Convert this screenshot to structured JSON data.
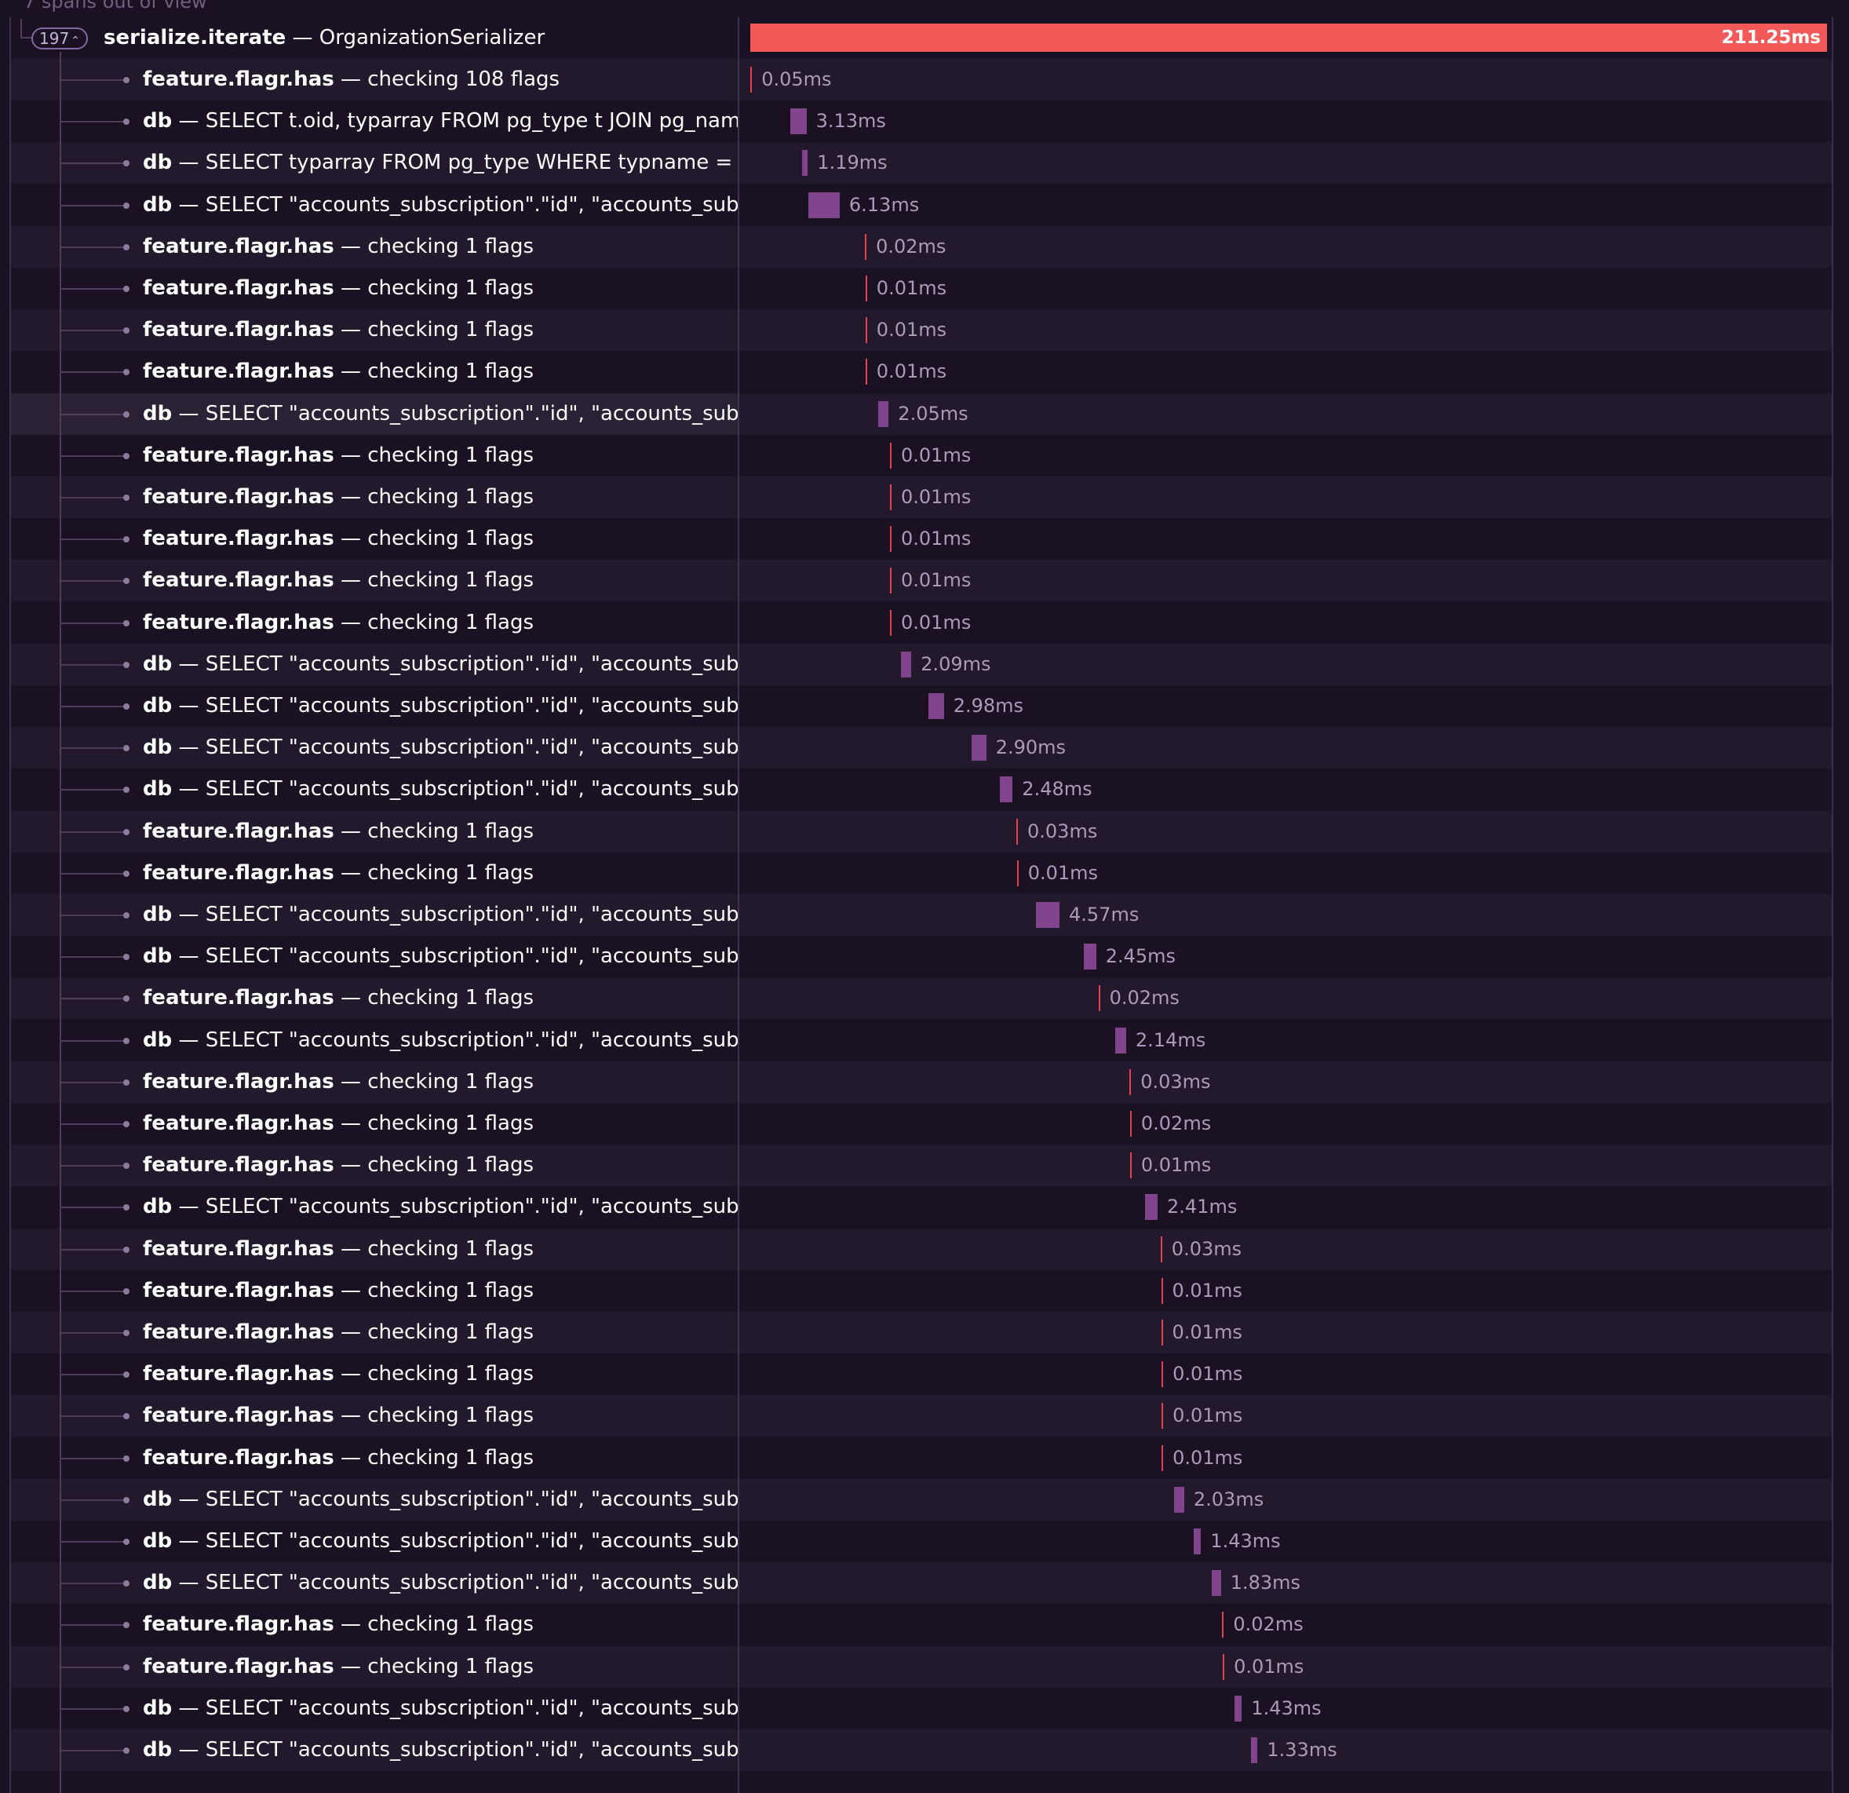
{
  "header": {
    "out_of_view": "7 spans out of view"
  },
  "root": {
    "count": "197",
    "op": "serialize.iterate",
    "sep": " — ",
    "desc": "OrganizationSerializer",
    "duration": "211.25ms"
  },
  "colors": {
    "root_bar": "#f25a5a",
    "db_bar": "#80448c",
    "flag_bar": "#e6414f",
    "background": "#1a1222",
    "row_alt": "#221a2c"
  },
  "spans": [
    {
      "type": "flag",
      "op": "feature.flagr.has",
      "desc": "checking 108 flags",
      "duration": "0.05ms",
      "start_ms": 0.03,
      "dur_ms": 0.05
    },
    {
      "type": "db",
      "op": "db",
      "desc": "SELECT t.oid, typarray FROM pg_type t JOIN pg_namespace ns ON typnamespace = ns.oid WHERE typname = 'hstore'",
      "duration": "3.13ms",
      "start_ms": 7.9,
      "dur_ms": 3.13
    },
    {
      "type": "db",
      "op": "db",
      "desc": "SELECT typarray FROM pg_type WHERE typname = 'citext'",
      "duration": "1.19ms",
      "start_ms": 10.1,
      "dur_ms": 1.19
    },
    {
      "type": "db",
      "op": "db",
      "desc": "SELECT \"accounts_subscription\".\"id\", \"accounts_subscription\".\"organization_id\"",
      "duration": "6.13ms",
      "start_ms": 11.4,
      "dur_ms": 6.13
    },
    {
      "type": "flag",
      "op": "feature.flagr.has",
      "desc": "checking 1 flags",
      "duration": "0.02ms",
      "start_ms": 22.5,
      "dur_ms": 0.02
    },
    {
      "type": "flag",
      "op": "feature.flagr.has",
      "desc": "checking 1 flags",
      "duration": "0.01ms",
      "start_ms": 22.6,
      "dur_ms": 0.01
    },
    {
      "type": "flag",
      "op": "feature.flagr.has",
      "desc": "checking 1 flags",
      "duration": "0.01ms",
      "start_ms": 22.6,
      "dur_ms": 0.01
    },
    {
      "type": "flag",
      "op": "feature.flagr.has",
      "desc": "checking 1 flags",
      "duration": "0.01ms",
      "start_ms": 22.6,
      "dur_ms": 0.01
    },
    {
      "type": "db",
      "op": "db",
      "desc": "SELECT \"accounts_subscription\".\"id\", \"accounts_subscription\".\"organization_id\"",
      "duration": "2.05ms",
      "start_ms": 25.1,
      "dur_ms": 2.05
    },
    {
      "type": "flag",
      "op": "feature.flagr.has",
      "desc": "checking 1 flags",
      "duration": "0.01ms",
      "start_ms": 27.4,
      "dur_ms": 0.01
    },
    {
      "type": "flag",
      "op": "feature.flagr.has",
      "desc": "checking 1 flags",
      "duration": "0.01ms",
      "start_ms": 27.4,
      "dur_ms": 0.01
    },
    {
      "type": "flag",
      "op": "feature.flagr.has",
      "desc": "checking 1 flags",
      "duration": "0.01ms",
      "start_ms": 27.4,
      "dur_ms": 0.01
    },
    {
      "type": "flag",
      "op": "feature.flagr.has",
      "desc": "checking 1 flags",
      "duration": "0.01ms",
      "start_ms": 27.4,
      "dur_ms": 0.01
    },
    {
      "type": "flag",
      "op": "feature.flagr.has",
      "desc": "checking 1 flags",
      "duration": "0.01ms",
      "start_ms": 27.4,
      "dur_ms": 0.01
    },
    {
      "type": "db",
      "op": "db",
      "desc": "SELECT \"accounts_subscription\".\"id\", \"accounts_subscription\".\"organization_id\"",
      "duration": "2.09ms",
      "start_ms": 29.5,
      "dur_ms": 2.09
    },
    {
      "type": "db",
      "op": "db",
      "desc": "SELECT \"accounts_subscription\".\"id\", \"accounts_subscription\".\"organization_id\"",
      "duration": "2.98ms",
      "start_ms": 35.0,
      "dur_ms": 2.98
    },
    {
      "type": "db",
      "op": "db",
      "desc": "SELECT \"accounts_subscription\".\"id\", \"accounts_subscription\".\"organization_id\"",
      "duration": "2.90ms",
      "start_ms": 43.4,
      "dur_ms": 2.9
    },
    {
      "type": "db",
      "op": "db",
      "desc": "SELECT \"accounts_subscription\".\"id\", \"accounts_subscription\".\"organization_id\"",
      "duration": "2.48ms",
      "start_ms": 49.0,
      "dur_ms": 2.48
    },
    {
      "type": "flag",
      "op": "feature.flagr.has",
      "desc": "checking 1 flags",
      "duration": "0.03ms",
      "start_ms": 52.2,
      "dur_ms": 0.03
    },
    {
      "type": "flag",
      "op": "feature.flagr.has",
      "desc": "checking 1 flags",
      "duration": "0.01ms",
      "start_ms": 52.3,
      "dur_ms": 0.01
    },
    {
      "type": "db",
      "op": "db",
      "desc": "SELECT \"accounts_subscription\".\"id\", \"accounts_subscription\".\"organization_id\"",
      "duration": "4.57ms",
      "start_ms": 56.1,
      "dur_ms": 4.57
    },
    {
      "type": "db",
      "op": "db",
      "desc": "SELECT \"accounts_subscription\".\"id\", \"accounts_subscription\".\"organization_id\"",
      "duration": "2.45ms",
      "start_ms": 65.4,
      "dur_ms": 2.45
    },
    {
      "type": "flag",
      "op": "feature.flagr.has",
      "desc": "checking 1 flags",
      "duration": "0.02ms",
      "start_ms": 68.3,
      "dur_ms": 0.02
    },
    {
      "type": "db",
      "op": "db",
      "desc": "SELECT \"accounts_subscription\".\"id\", \"accounts_subscription\".\"organization_id\"",
      "duration": "2.14ms",
      "start_ms": 71.6,
      "dur_ms": 2.14
    },
    {
      "type": "flag",
      "op": "feature.flagr.has",
      "desc": "checking 1 flags",
      "duration": "0.03ms",
      "start_ms": 74.4,
      "dur_ms": 0.03
    },
    {
      "type": "flag",
      "op": "feature.flagr.has",
      "desc": "checking 1 flags",
      "duration": "0.02ms",
      "start_ms": 74.5,
      "dur_ms": 0.02
    },
    {
      "type": "flag",
      "op": "feature.flagr.has",
      "desc": "checking 1 flags",
      "duration": "0.01ms",
      "start_ms": 74.5,
      "dur_ms": 0.01
    },
    {
      "type": "db",
      "op": "db",
      "desc": "SELECT \"accounts_subscription\".\"id\", \"accounts_subscription\".\"organization_id\"",
      "duration": "2.41ms",
      "start_ms": 77.5,
      "dur_ms": 2.41
    },
    {
      "type": "flag",
      "op": "feature.flagr.has",
      "desc": "checking 1 flags",
      "duration": "0.03ms",
      "start_ms": 80.5,
      "dur_ms": 0.03
    },
    {
      "type": "flag",
      "op": "feature.flagr.has",
      "desc": "checking 1 flags",
      "duration": "0.01ms",
      "start_ms": 80.6,
      "dur_ms": 0.01
    },
    {
      "type": "flag",
      "op": "feature.flagr.has",
      "desc": "checking 1 flags",
      "duration": "0.01ms",
      "start_ms": 80.6,
      "dur_ms": 0.01
    },
    {
      "type": "flag",
      "op": "feature.flagr.has",
      "desc": "checking 1 flags",
      "duration": "0.01ms",
      "start_ms": 80.7,
      "dur_ms": 0.01
    },
    {
      "type": "flag",
      "op": "feature.flagr.has",
      "desc": "checking 1 flags",
      "duration": "0.01ms",
      "start_ms": 80.7,
      "dur_ms": 0.01
    },
    {
      "type": "flag",
      "op": "feature.flagr.has",
      "desc": "checking 1 flags",
      "duration": "0.01ms",
      "start_ms": 80.7,
      "dur_ms": 0.01
    },
    {
      "type": "db",
      "op": "db",
      "desc": "SELECT \"accounts_subscription\".\"id\", \"accounts_subscription\".\"organization_id\"",
      "duration": "2.03ms",
      "start_ms": 83.1,
      "dur_ms": 2.03
    },
    {
      "type": "db",
      "op": "db",
      "desc": "SELECT \"accounts_subscription\".\"id\", \"accounts_subscription\".\"organization_id\"",
      "duration": "1.43ms",
      "start_ms": 87.0,
      "dur_ms": 1.43
    },
    {
      "type": "db",
      "op": "db",
      "desc": "SELECT \"accounts_subscription\".\"id\", \"accounts_subscription\".\"organization_id\"",
      "duration": "1.83ms",
      "start_ms": 90.5,
      "dur_ms": 1.83
    },
    {
      "type": "flag",
      "op": "feature.flagr.has",
      "desc": "checking 1 flags",
      "duration": "0.02ms",
      "start_ms": 92.6,
      "dur_ms": 0.02
    },
    {
      "type": "flag",
      "op": "feature.flagr.has",
      "desc": "checking 1 flags",
      "duration": "0.01ms",
      "start_ms": 92.7,
      "dur_ms": 0.01
    },
    {
      "type": "db",
      "op": "db",
      "desc": "SELECT \"accounts_subscription\".\"id\", \"accounts_subscription\".\"organization_id\"",
      "duration": "1.43ms",
      "start_ms": 95.0,
      "dur_ms": 1.43
    },
    {
      "type": "db",
      "op": "db",
      "desc": "SELECT \"accounts_subscription\".\"id\", \"accounts_subscription\".\"organization_id\"",
      "duration": "1.33ms",
      "start_ms": 98.2,
      "dur_ms": 1.33
    }
  ]
}
